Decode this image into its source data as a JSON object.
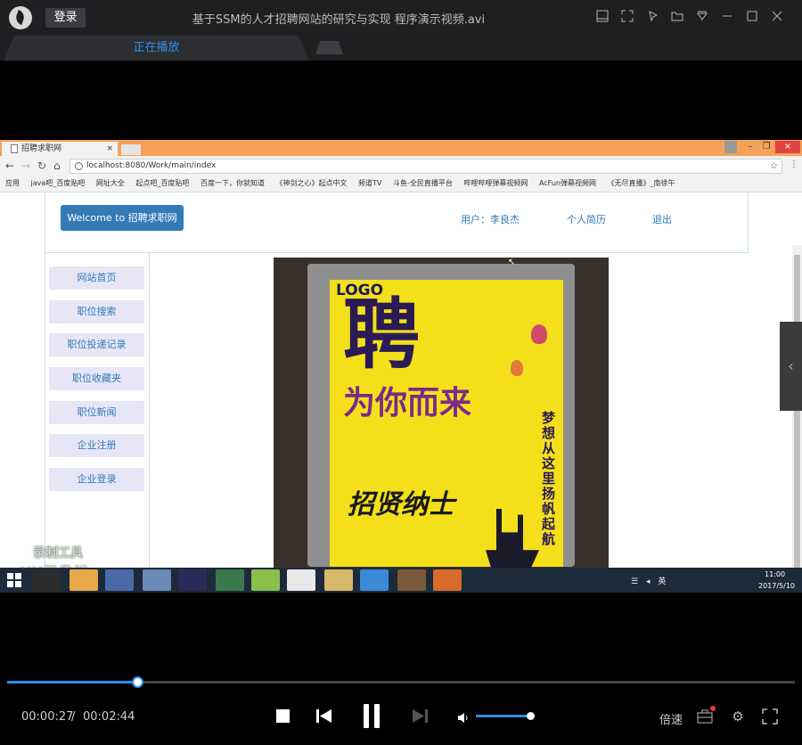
{
  "player": {
    "login_label": "登录",
    "title": "基于SSM的人才招聘网站的研究与实现 程序演示视频.avi",
    "tab_playing": "正在播放",
    "time_current": "00:00:27",
    "time_separator": "/",
    "time_total": "00:02:44",
    "progress_fraction": 0.165,
    "volume_fraction": 1.0,
    "speed_label": "倍速",
    "accent_color": "#2f8ee8"
  },
  "browser": {
    "tab_title": "招聘求职网",
    "url": "localhost:8080/Work/main/index",
    "bookmarks": [
      "应用",
      "java吧_百度贴吧",
      "网址大全",
      "起点吧_百度贴吧",
      "百度一下，你就知道",
      "《神剑之心》起点中文",
      "频道TV",
      "斗鱼-全民直播平台",
      "哔哩哔哩弹幕视频网",
      "AcFun弹幕视频网",
      "《无尽直播》_南徐午"
    ]
  },
  "site": {
    "welcome": "Welcome to 招聘求职网",
    "user_label": "用户：李良杰",
    "resume_label": "个人简历",
    "logout_label": "退出",
    "menu": [
      "网站首页",
      "职位搜索",
      "职位投递记录",
      "职位收藏夹",
      "职位新闻",
      "企业注册",
      "企业登录"
    ],
    "poster": {
      "logo": "LOGO",
      "headline": "聘",
      "slogan": "为你而来",
      "side_text": "梦想从这里扬帆起航",
      "sub": "招贤纳士"
    }
  },
  "watermark": {
    "line1": "录制工具",
    "line2": "KK录像机"
  },
  "taskbar": {
    "time": "11:00",
    "date": "2017/5/10",
    "ime": "英"
  }
}
